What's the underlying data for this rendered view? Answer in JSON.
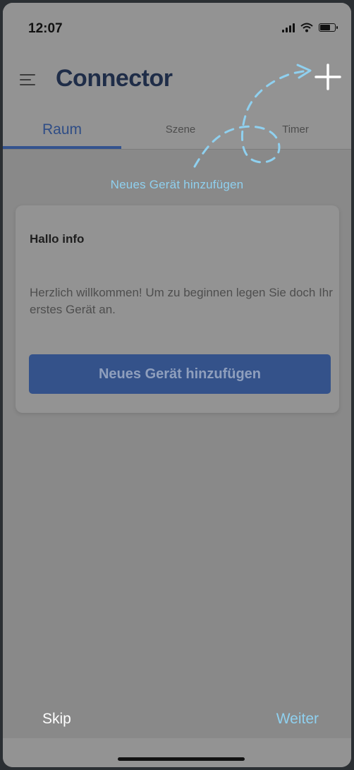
{
  "status_bar": {
    "time": "12:07"
  },
  "header": {
    "title": "Connector",
    "menu_icon": "hamburger-menu-icon",
    "add_icon": "plus-icon"
  },
  "tabs": [
    {
      "label": "Raum",
      "active": true
    },
    {
      "label": "Szene",
      "active": false
    },
    {
      "label": "Timer",
      "active": false
    }
  ],
  "coach": {
    "hint": "Neues Gerät hinzufügen",
    "hint_color": "#8fd0ef"
  },
  "card": {
    "title": "Hallo info",
    "text": "Herzlich willkommen! Um zu beginnen legen Sie doch Ihr erstes Gerät an.",
    "button_label": "Neues Gerät hinzufügen",
    "button_color": "#34528a"
  },
  "footer": {
    "skip_label": "Skip",
    "next_label": "Weiter"
  },
  "colors": {
    "accent": "#34538e",
    "overlay_background": "#898989"
  }
}
